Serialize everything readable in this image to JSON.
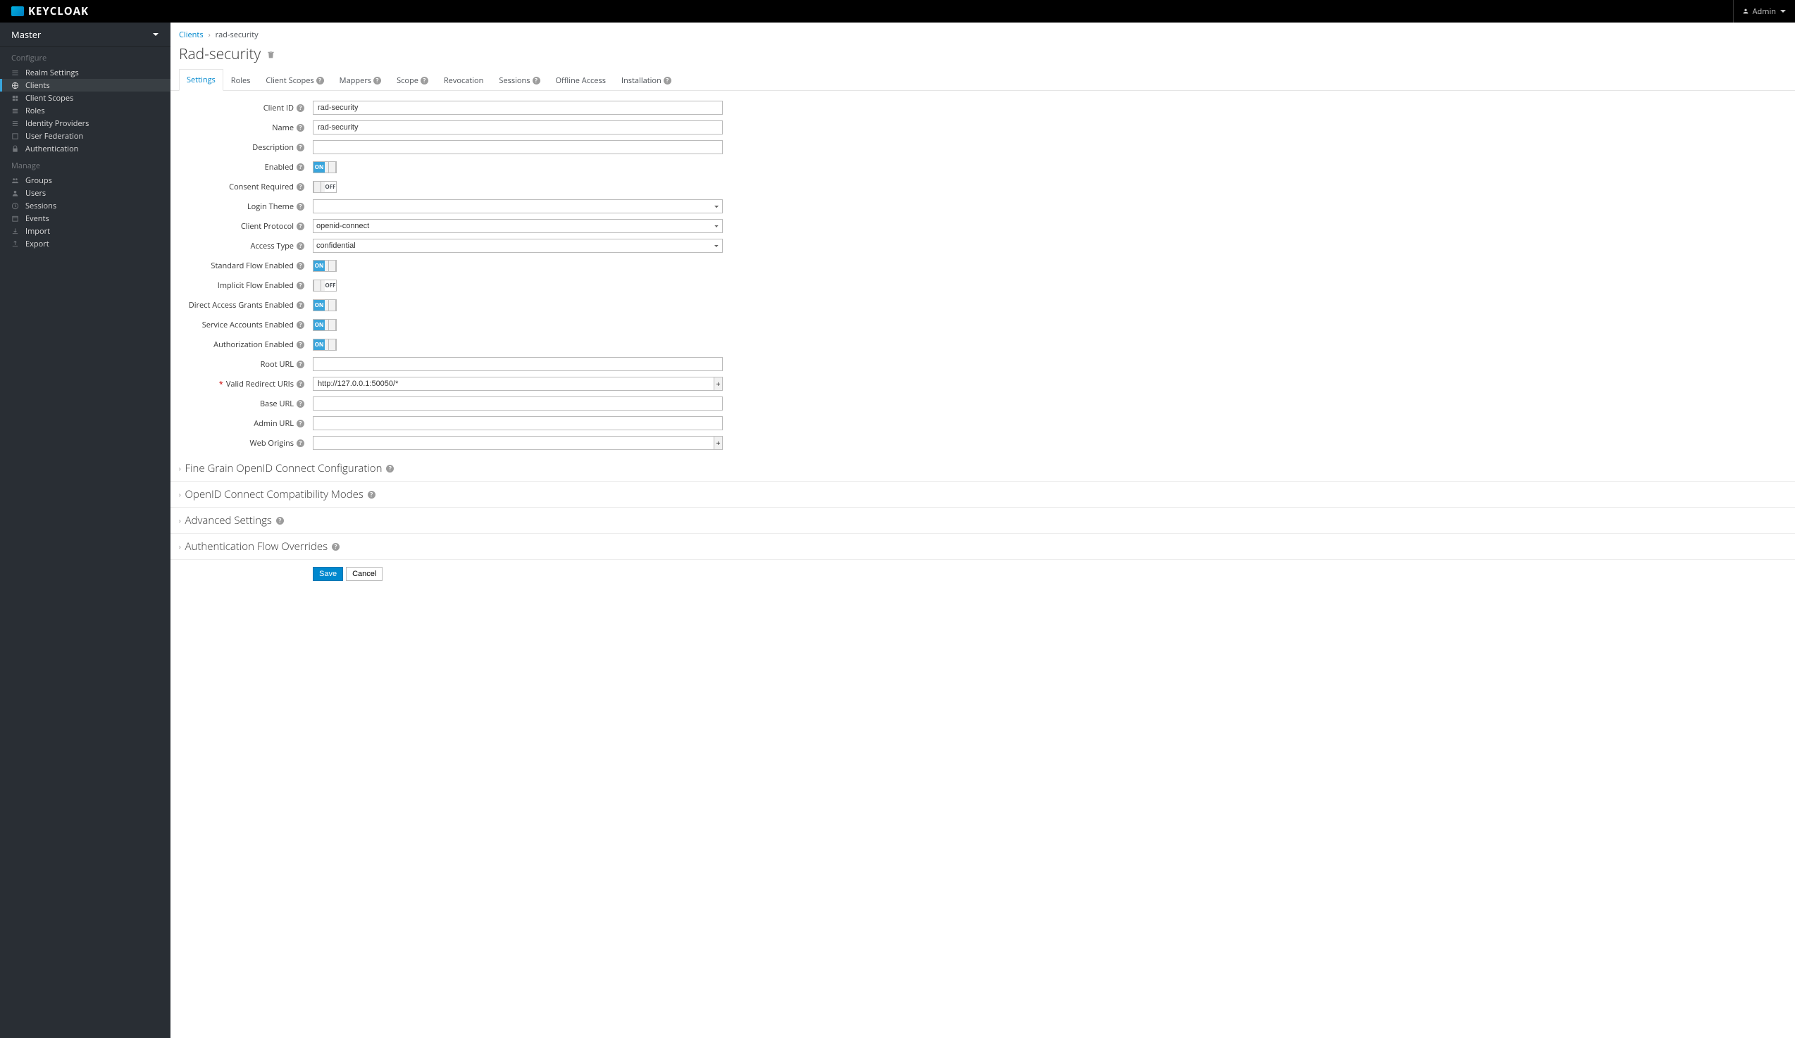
{
  "header": {
    "logo_text": "KEYCLOAK",
    "admin_label": "Admin"
  },
  "sidebar": {
    "realm": "Master",
    "sections": {
      "configure": {
        "title": "Configure",
        "items": [
          "Realm Settings",
          "Clients",
          "Client Scopes",
          "Roles",
          "Identity Providers",
          "User Federation",
          "Authentication"
        ]
      },
      "manage": {
        "title": "Manage",
        "items": [
          "Groups",
          "Users",
          "Sessions",
          "Events",
          "Import",
          "Export"
        ]
      }
    }
  },
  "breadcrumb": {
    "root": "Clients",
    "current": "rad-security"
  },
  "page": {
    "title": "Rad-security"
  },
  "tabs": [
    "Settings",
    "Roles",
    "Client Scopes",
    "Mappers",
    "Scope",
    "Revocation",
    "Sessions",
    "Offline Access",
    "Installation"
  ],
  "tab_help": {
    "2": true,
    "3": true,
    "4": true,
    "6": true,
    "8": true
  },
  "form": {
    "client_id": {
      "label": "Client ID",
      "value": "rad-security"
    },
    "name": {
      "label": "Name",
      "value": "rad-security"
    },
    "description": {
      "label": "Description",
      "value": ""
    },
    "enabled": {
      "label": "Enabled",
      "value": true
    },
    "consent_required": {
      "label": "Consent Required",
      "value": false
    },
    "login_theme": {
      "label": "Login Theme",
      "value": ""
    },
    "client_protocol": {
      "label": "Client Protocol",
      "value": "openid-connect"
    },
    "access_type": {
      "label": "Access Type",
      "value": "confidential"
    },
    "standard_flow": {
      "label": "Standard Flow Enabled",
      "value": true
    },
    "implicit_flow": {
      "label": "Implicit Flow Enabled",
      "value": false
    },
    "direct_access": {
      "label": "Direct Access Grants Enabled",
      "value": true
    },
    "service_accounts": {
      "label": "Service Accounts Enabled",
      "value": true
    },
    "authorization": {
      "label": "Authorization Enabled",
      "value": true
    },
    "root_url": {
      "label": "Root URL",
      "value": ""
    },
    "valid_redirect": {
      "label": "Valid Redirect URIs",
      "value": "http://127.0.0.1:50050/*"
    },
    "base_url": {
      "label": "Base URL",
      "value": ""
    },
    "admin_url": {
      "label": "Admin URL",
      "value": ""
    },
    "web_origins": {
      "label": "Web Origins",
      "value": ""
    }
  },
  "collapsibles": [
    "Fine Grain OpenID Connect Configuration",
    "OpenID Connect Compatibility Modes",
    "Advanced Settings",
    "Authentication Flow Overrides"
  ],
  "buttons": {
    "save": "Save",
    "cancel": "Cancel"
  },
  "toggle_text": {
    "on": "ON",
    "off": "OFF"
  }
}
